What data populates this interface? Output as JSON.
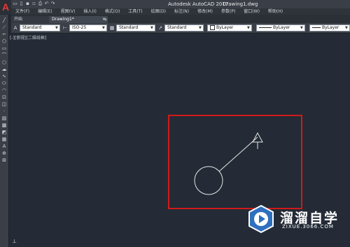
{
  "titlebar": {
    "title": "Autodesk AutoCAD 2017",
    "document": "Drawing1.dwg",
    "qat_icons": [
      "new-file-icon",
      "open-icon",
      "save-icon",
      "saveas-icon",
      "print-icon",
      "undo-icon",
      "redo-icon"
    ]
  },
  "menubar": {
    "items": [
      "文件(F)",
      "编辑(E)",
      "视图(V)",
      "插入(I)",
      "格式(O)",
      "工具(T)",
      "绘图(D)",
      "标注(N)",
      "修改(M)",
      "参数(P)",
      "窗口(W)",
      "帮助(H)"
    ]
  },
  "tabs": {
    "start": "开始",
    "drawing": "Drawing1*",
    "close": "×",
    "add": "+"
  },
  "properties": {
    "text_style": "Standard",
    "dim_style": "ISO-25",
    "table_style": "Standard",
    "mleader_style": "Standard",
    "color": "ByLayer",
    "linetype": "ByLayer",
    "lineweight": "ByLayer"
  },
  "viewport": {
    "label": "[-][俯视][二维线框]"
  },
  "watermark": {
    "title": "溜溜自学",
    "url": "ZIXUE.3066.COM"
  },
  "colors": {
    "canvas": "#242b36",
    "highlight": "#d21a1a",
    "geometry": "#e6e6e6",
    "watermark_logo": "#2f6fbf"
  }
}
